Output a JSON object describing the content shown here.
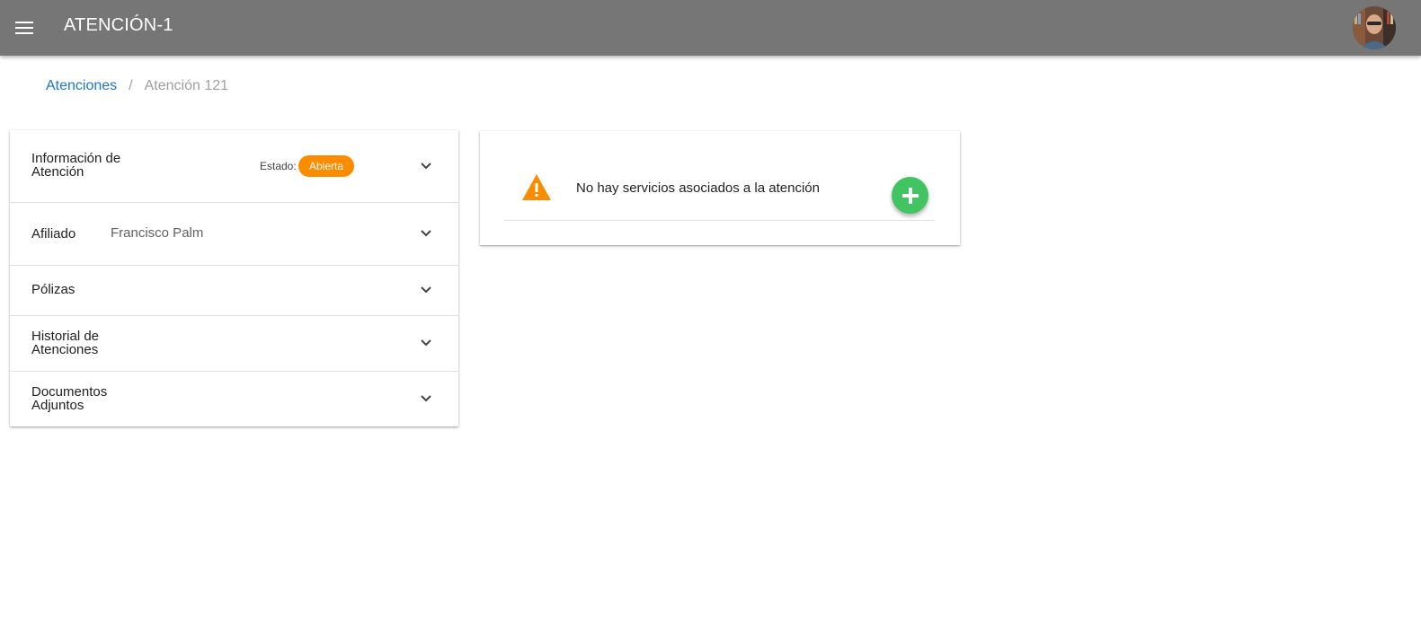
{
  "header": {
    "title": "ATENCIÓN-1",
    "menu_icon": "menu-icon",
    "avatar": "user-avatar",
    "bar_color": "#767676"
  },
  "breadcrumb": {
    "link": "Atenciones",
    "separator": "/",
    "current": "Atención 121"
  },
  "panels": [
    {
      "title_line1": "Información de",
      "title_line2": "Atención",
      "status_label": "Estado:",
      "status_value": "Abierta",
      "status_color": "#fb8c00"
    },
    {
      "title": "Afiliado",
      "value": "Francisco Palm"
    },
    {
      "title": "Pólizas"
    },
    {
      "title_line1": "Historial de",
      "title_line2": "Atenciones"
    },
    {
      "title_line1": "Documentos",
      "title_line2": "Adjuntos"
    }
  ],
  "services": {
    "empty_message": "No hay servicios asociados a la atención",
    "warning_icon": "warning-icon",
    "warning_color": "#fb8c00",
    "add_icon": "plus-icon",
    "add_color": "#43c463"
  }
}
